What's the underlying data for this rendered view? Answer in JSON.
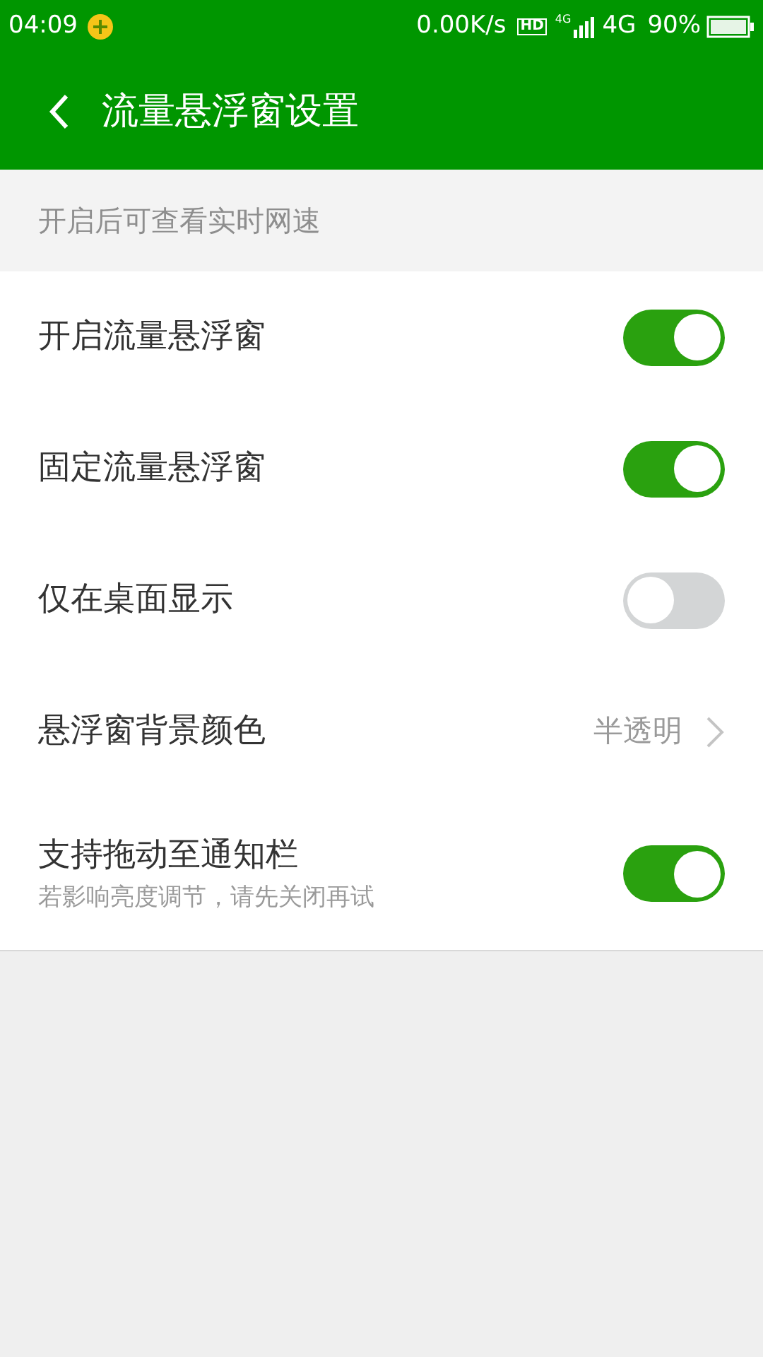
{
  "status_bar": {
    "time": "04:09",
    "speed": "0.00K/s",
    "hd": "HD",
    "network_small": "4G",
    "network": "4G",
    "battery": "90%"
  },
  "header": {
    "title": "流量悬浮窗设置"
  },
  "section": {
    "title": "开启后可查看实时网速"
  },
  "settings": [
    {
      "kind": "toggle",
      "label": "开启流量悬浮窗",
      "on": true
    },
    {
      "kind": "toggle",
      "label": "固定流量悬浮窗",
      "on": true
    },
    {
      "kind": "toggle",
      "label": "仅在桌面显示",
      "on": false
    },
    {
      "kind": "link",
      "label": "悬浮窗背景颜色",
      "value": "半透明"
    },
    {
      "kind": "toggle",
      "label": "支持拖动至通知栏",
      "subtitle": "若影响亮度调节，请先关闭再试",
      "on": true
    }
  ]
}
